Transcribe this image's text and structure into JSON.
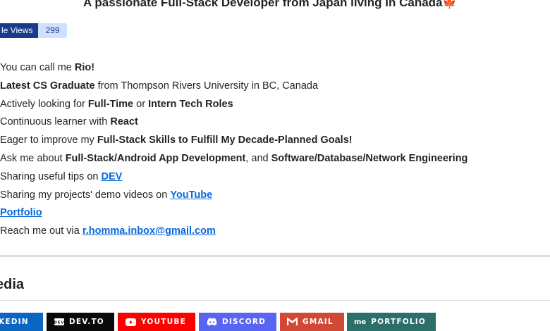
{
  "header": {
    "subtitle": "A passionate Full-Stack Developer from Japan living in Canada",
    "flag_icon": "canada-maple-leaf-icon"
  },
  "views_badge": {
    "label": "le Views",
    "count": "299"
  },
  "about": [
    [
      {
        "t": "You can call me "
      },
      {
        "t": "Rio!",
        "s": "b"
      }
    ],
    [
      {
        "t": "Latest CS Graduate",
        "s": "b"
      },
      {
        "t": " from Thompson Rivers University in BC, Canada"
      }
    ],
    [
      {
        "t": "Actively looking for "
      },
      {
        "t": "Full-Time",
        "s": "b"
      },
      {
        "t": " or "
      },
      {
        "t": "Intern Tech Roles",
        "s": "b"
      }
    ],
    [
      {
        "t": "Continuous learner with "
      },
      {
        "t": "React",
        "s": "b"
      }
    ],
    [
      {
        "t": "Eager to improve my "
      },
      {
        "t": "Full-Stack Skills to Fulfill My Decade-Planned Goals!",
        "s": "b"
      }
    ],
    [
      {
        "t": "Ask me about "
      },
      {
        "t": "Full-Stack/Android App Development",
        "s": "b"
      },
      {
        "t": ", and "
      },
      {
        "t": "Software/Database/Network Engineering",
        "s": "b"
      }
    ],
    [
      {
        "t": "Sharing useful tips on "
      },
      {
        "t": "DEV",
        "s": "a"
      }
    ],
    [
      {
        "t": "Sharing my projects' demo videos on "
      },
      {
        "t": "YouTube",
        "s": "a"
      }
    ],
    [
      {
        "t": "Portfolio",
        "s": "a"
      }
    ],
    [
      {
        "t": "Reach me out via "
      },
      {
        "t": "r.homma.inbox@gmail.com",
        "s": "a"
      }
    ]
  ],
  "section": {
    "title": "edia"
  },
  "social_badges": {
    "linkedin": "KEDIN",
    "devto": "DEV.TO",
    "youtube": "YOUTUBE",
    "discord": "DISCORD",
    "gmail": "GMAIL",
    "portfolio": "PORTFOLIO",
    "portfolio_mark": "me",
    "devto_mark": "DEV"
  },
  "colors": {
    "link": "#0969da",
    "linkedin": "#0a66c2",
    "devto": "#0a0a0a",
    "youtube": "#ff0000",
    "discord": "#5865f2",
    "gmail": "#d14836",
    "portfolio": "#2c6e6a"
  }
}
